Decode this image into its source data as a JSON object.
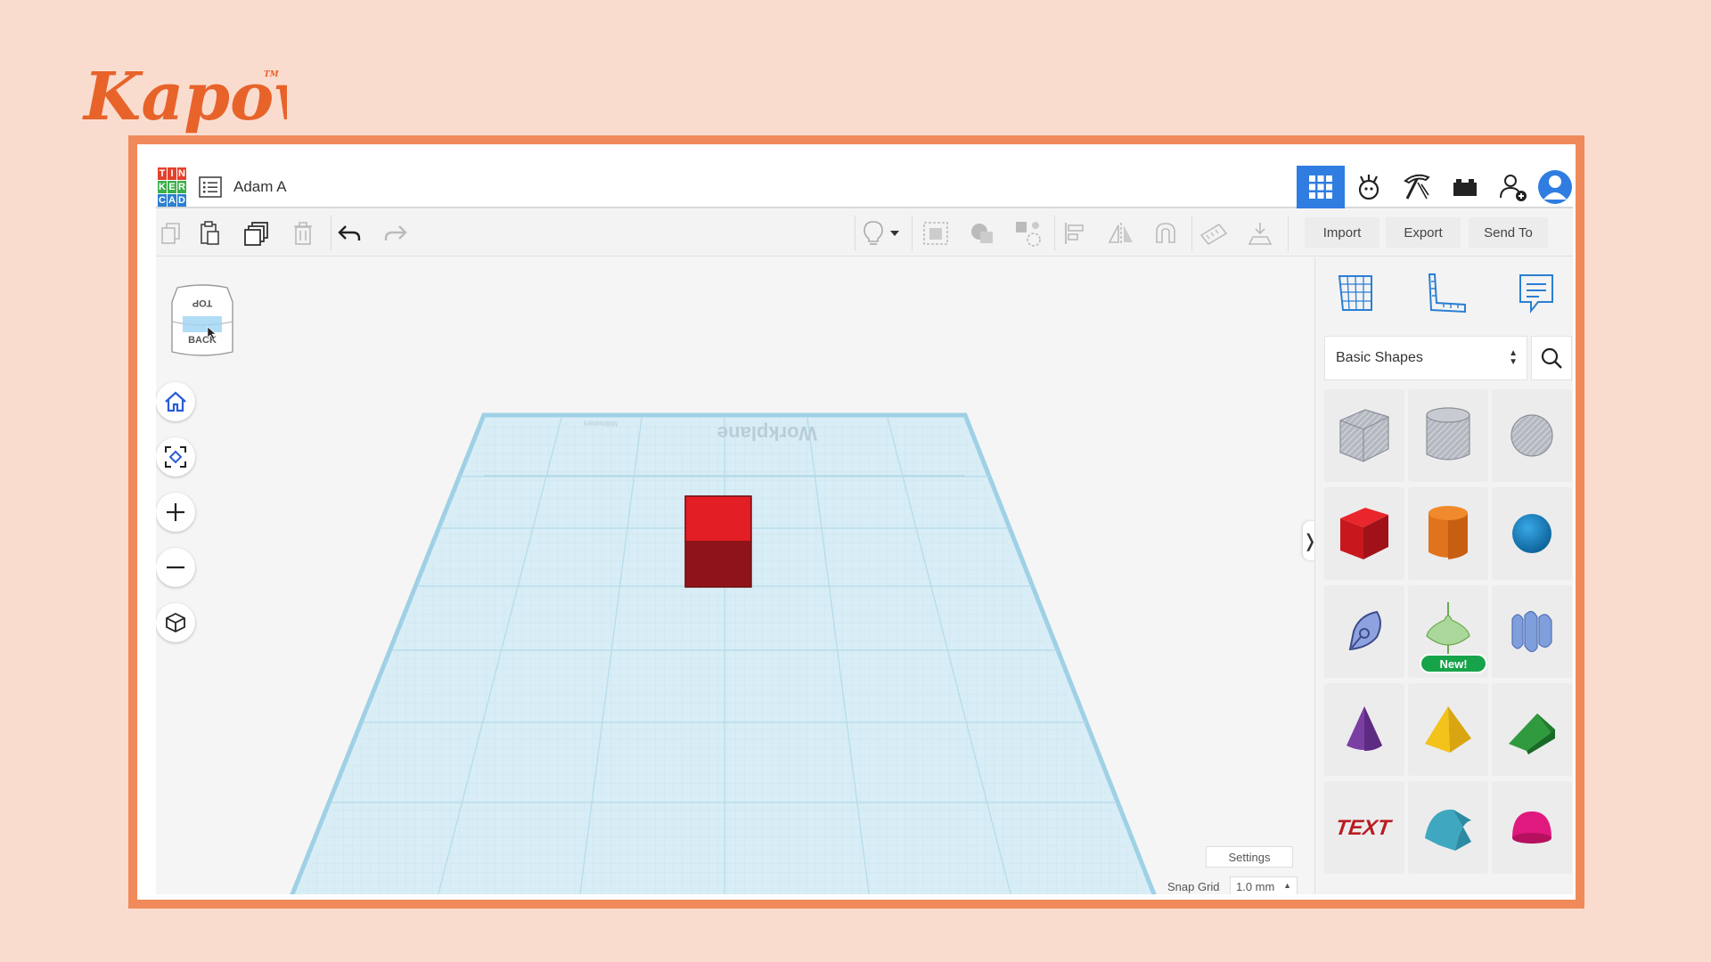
{
  "brand": {
    "logo_text": "Kapow",
    "trademark": "TM"
  },
  "app": {
    "logo_letters": [
      "T",
      "I",
      "N",
      "K",
      "E",
      "R",
      "C",
      "A",
      "D"
    ],
    "logo_colors": [
      "#e2412c",
      "#e2412c",
      "#e2412c",
      "#3cae4a",
      "#3cae4a",
      "#3cae4a",
      "#2b7fd0",
      "#2b7fd0",
      "#2b7fd0"
    ],
    "design_name": "Adam A",
    "top_icons": [
      "grid-view-icon",
      "blocks-icon",
      "minecraft-pickaxe-icon",
      "lego-bricks-icon",
      "add-user-icon",
      "user-avatar-icon"
    ]
  },
  "toolbar": {
    "left_tools": [
      "copy-icon",
      "paste-icon",
      "duplicate-icon",
      "delete-icon",
      "undo-icon",
      "redo-icon"
    ],
    "right_tools": [
      "lightbulb-icon",
      "dropdown-caret-icon",
      "hole-icon",
      "solid-icon",
      "group-icon",
      "align-icon",
      "mirror-icon",
      "magnet-icon",
      "ruler-icon",
      "workplane-drop-icon"
    ],
    "import_label": "Import",
    "export_label": "Export",
    "send_to_label": "Send To"
  },
  "viewport": {
    "viewcube": {
      "top_label": "TOP",
      "back_label": "BACK"
    },
    "nav_buttons": [
      "home-icon",
      "fit-view-icon",
      "zoom-in-icon",
      "zoom-out-icon",
      "perspective-icon"
    ],
    "workplane_label": "Workplane",
    "workplane_units": "Millimeters",
    "settings_label": "Settings",
    "snap_grid_label": "Snap Grid",
    "snap_grid_value": "1.0 mm",
    "collapse_arrow": "❭",
    "cube_color": "#d42027"
  },
  "panel": {
    "tabs": [
      "workplane-grid-icon",
      "ruler-tool-icon",
      "notes-icon"
    ],
    "category": "Basic Shapes",
    "shapes": [
      "box-hole",
      "cylinder-hole",
      "sphere-hole",
      "box",
      "cylinder",
      "sphere",
      "scribble",
      "spinning-top",
      "text-wave",
      "cone",
      "pyramid",
      "wedge",
      "text",
      "half-cylinder",
      "paraboloid"
    ],
    "new_badge": "New!",
    "text_shape_label": "TEXT"
  }
}
